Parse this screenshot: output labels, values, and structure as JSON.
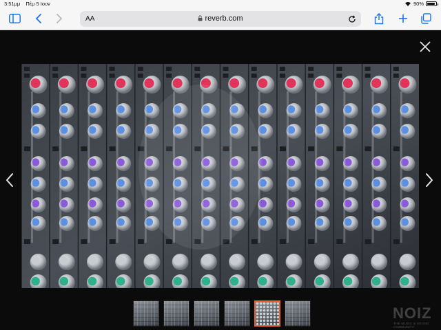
{
  "status_bar": {
    "time": "3:51μμ",
    "date": "Πέμ 5 Ιουν",
    "battery": "90%",
    "battery_level": 0.9
  },
  "toolbar": {
    "text_size_label": "AA",
    "url": "reverb.com"
  },
  "icons": {
    "sidebar": "sidebar-icon",
    "back": "chevron-left-icon",
    "forward": "chevron-right-icon",
    "lock": "lock-icon",
    "reload": "reload-icon",
    "share": "share-icon",
    "new_tab": "plus-icon",
    "tabs": "tabs-icon",
    "close": "close-icon",
    "prev": "chevron-left-icon",
    "next": "chevron-right-icon"
  },
  "gallery": {
    "thumbnail_count": 6,
    "active_index": 4
  },
  "watermark": {
    "logo": "NOIZ",
    "tagline": "the music & sound community"
  },
  "colors": {
    "accent": "#e6662b",
    "knob_red": "#e0345a",
    "knob_blue": "#5b8fe0",
    "knob_purple": "#8a5ad8",
    "knob_green": "#2fb08a"
  }
}
